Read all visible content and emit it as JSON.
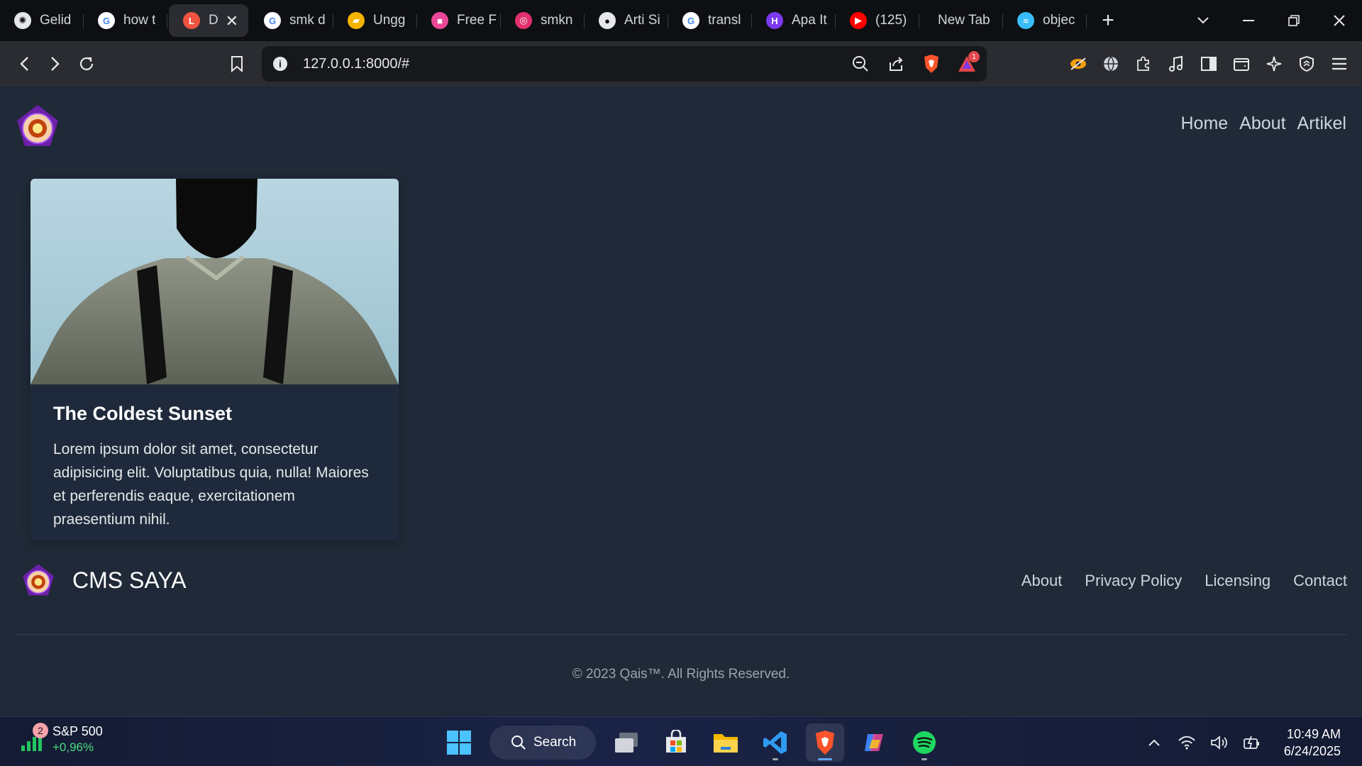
{
  "browser": {
    "tabs": [
      {
        "label": "Gelid",
        "icon": "openai-icon",
        "color": "#e5e7eb"
      },
      {
        "label": "how t",
        "icon": "google-icon",
        "color": "#4285f4"
      },
      {
        "label": "D",
        "icon": "laravel-icon",
        "color": "#f05340",
        "active": true
      },
      {
        "label": "smk d",
        "icon": "google-icon",
        "color": "#4285f4"
      },
      {
        "label": "Ungg",
        "icon": "slides-icon",
        "color": "#f4b400"
      },
      {
        "label": "Free F",
        "icon": "colorful-icon",
        "color": "#ec4899"
      },
      {
        "label": "smkn",
        "icon": "instagram-icon",
        "color": "#e1306c"
      },
      {
        "label": "Arti Si",
        "icon": "site-icon",
        "color": "#9ca3af"
      },
      {
        "label": "transl",
        "icon": "google-icon",
        "color": "#4285f4"
      },
      {
        "label": "Apa It",
        "icon": "h-logo-icon",
        "color": "#7c3aed"
      },
      {
        "label": "(125)",
        "icon": "youtube-icon",
        "color": "#ff0000"
      },
      {
        "label": "New Tab",
        "icon": "",
        "color": ""
      },
      {
        "label": "objec",
        "icon": "tailwind-icon",
        "color": "#38bdf8"
      }
    ],
    "url": "127.0.0.1:8000/#",
    "notification_count": "1"
  },
  "site": {
    "nav": [
      "Home",
      "About",
      "Artikel"
    ],
    "card": {
      "title": "The Coldest Sunset",
      "body": "Lorem ipsum dolor sit amet, consectetur adipisicing elit. Voluptatibus quia, nulla! Maiores et perferendis eaque, exercitationem praesentium nihil."
    },
    "footer": {
      "brand": "CMS SAYA",
      "links": [
        "About",
        "Privacy Policy",
        "Licensing",
        "Contact"
      ],
      "copyright": "© 2023 Qais™. All Rights Reserved."
    }
  },
  "taskbar": {
    "widget": {
      "name": "S&P 500",
      "change": "+0,96%",
      "badge": "2"
    },
    "search_label": "Search",
    "time": "10:49 AM",
    "date": "6/24/2025"
  }
}
